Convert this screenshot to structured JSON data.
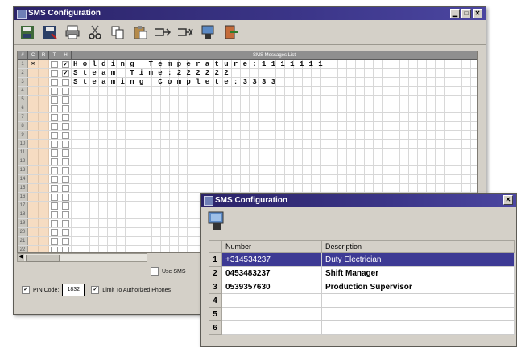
{
  "back_window": {
    "title": "SMS Configuration",
    "controls": [
      "▁",
      "□",
      "✕"
    ],
    "toolbar_icons": [
      "save-icon",
      "save-as-icon",
      "print-icon",
      "cut-icon",
      "copy-icon",
      "paste-icon",
      "insert-row-icon",
      "delete-row-icon",
      "phone-config-icon",
      "exit-icon"
    ],
    "grid": {
      "header_cols": [
        "#",
        "C",
        "R",
        "T",
        "H"
      ],
      "message_header": "SMS Messages List",
      "rows": [
        {
          "num": "1",
          "peach_mark": "✕",
          "check1": "",
          "check2": "✓",
          "message": "Holding Temperature:1111111"
        },
        {
          "num": "2",
          "peach_mark": "",
          "check1": "",
          "check2": "✓",
          "message": "Steam Time:222222"
        },
        {
          "num": "3",
          "peach_mark": "",
          "check1": "",
          "check2": "",
          "message": "Steaming Complete:3333"
        },
        {
          "num": "4",
          "peach_mark": "",
          "check1": "",
          "check2": "",
          "message": ""
        },
        {
          "num": "5",
          "peach_mark": "",
          "check1": "",
          "check2": "",
          "message": ""
        },
        {
          "num": "6",
          "peach_mark": "",
          "check1": "",
          "check2": "",
          "message": ""
        },
        {
          "num": "7",
          "peach_mark": "",
          "check1": "",
          "check2": "",
          "message": ""
        },
        {
          "num": "8",
          "peach_mark": "",
          "check1": "",
          "check2": "",
          "message": ""
        },
        {
          "num": "9",
          "peach_mark": "",
          "check1": "",
          "check2": "",
          "message": ""
        },
        {
          "num": "10",
          "peach_mark": "",
          "check1": "",
          "check2": "",
          "message": ""
        },
        {
          "num": "11",
          "peach_mark": "",
          "check1": "",
          "check2": "",
          "message": ""
        },
        {
          "num": "12",
          "peach_mark": "",
          "check1": "",
          "check2": "",
          "message": ""
        },
        {
          "num": "13",
          "peach_mark": "",
          "check1": "",
          "check2": "",
          "message": ""
        },
        {
          "num": "14",
          "peach_mark": "",
          "check1": "",
          "check2": "",
          "message": ""
        },
        {
          "num": "15",
          "peach_mark": "",
          "check1": "",
          "check2": "",
          "message": ""
        },
        {
          "num": "16",
          "peach_mark": "",
          "check1": "",
          "check2": "",
          "message": ""
        },
        {
          "num": "17",
          "peach_mark": "",
          "check1": "",
          "check2": "",
          "message": ""
        },
        {
          "num": "18",
          "peach_mark": "",
          "check1": "",
          "check2": "",
          "message": ""
        },
        {
          "num": "19",
          "peach_mark": "",
          "check1": "",
          "check2": "",
          "message": ""
        },
        {
          "num": "20",
          "peach_mark": "",
          "check1": "",
          "check2": "",
          "message": ""
        },
        {
          "num": "21",
          "peach_mark": "",
          "check1": "",
          "check2": "",
          "message": ""
        },
        {
          "num": "22",
          "peach_mark": "",
          "check1": "",
          "check2": "",
          "message": ""
        }
      ]
    },
    "footer": {
      "use_sms_label": "Use SMS",
      "pin_code_label": "PIN Code:",
      "pin_code_value": "1832",
      "limit_label": "Limit To Authorized Phones"
    }
  },
  "front_window": {
    "title": "SMS Configuration",
    "close_label": "✕",
    "toolbar_icon": "phone-config-icon",
    "table": {
      "headers": [
        "Number",
        "Description"
      ],
      "rows": [
        {
          "index": "1",
          "number": "+314534237",
          "description": "Duty Electrician",
          "selected": true
        },
        {
          "index": "2",
          "number": "0453483237",
          "description": "Shift Manager",
          "selected": false
        },
        {
          "index": "3",
          "number": "0539357630",
          "description": "Production Supervisor",
          "selected": false
        },
        {
          "index": "4",
          "number": "",
          "description": "",
          "selected": false
        },
        {
          "index": "5",
          "number": "",
          "description": "",
          "selected": false
        },
        {
          "index": "6",
          "number": "",
          "description": "",
          "selected": false
        }
      ]
    }
  },
  "colors": {
    "titlebar": "#2b2368",
    "window_bg": "#d4d0c8",
    "selection": "#3d3a94",
    "peach": "#f6dcc2"
  }
}
